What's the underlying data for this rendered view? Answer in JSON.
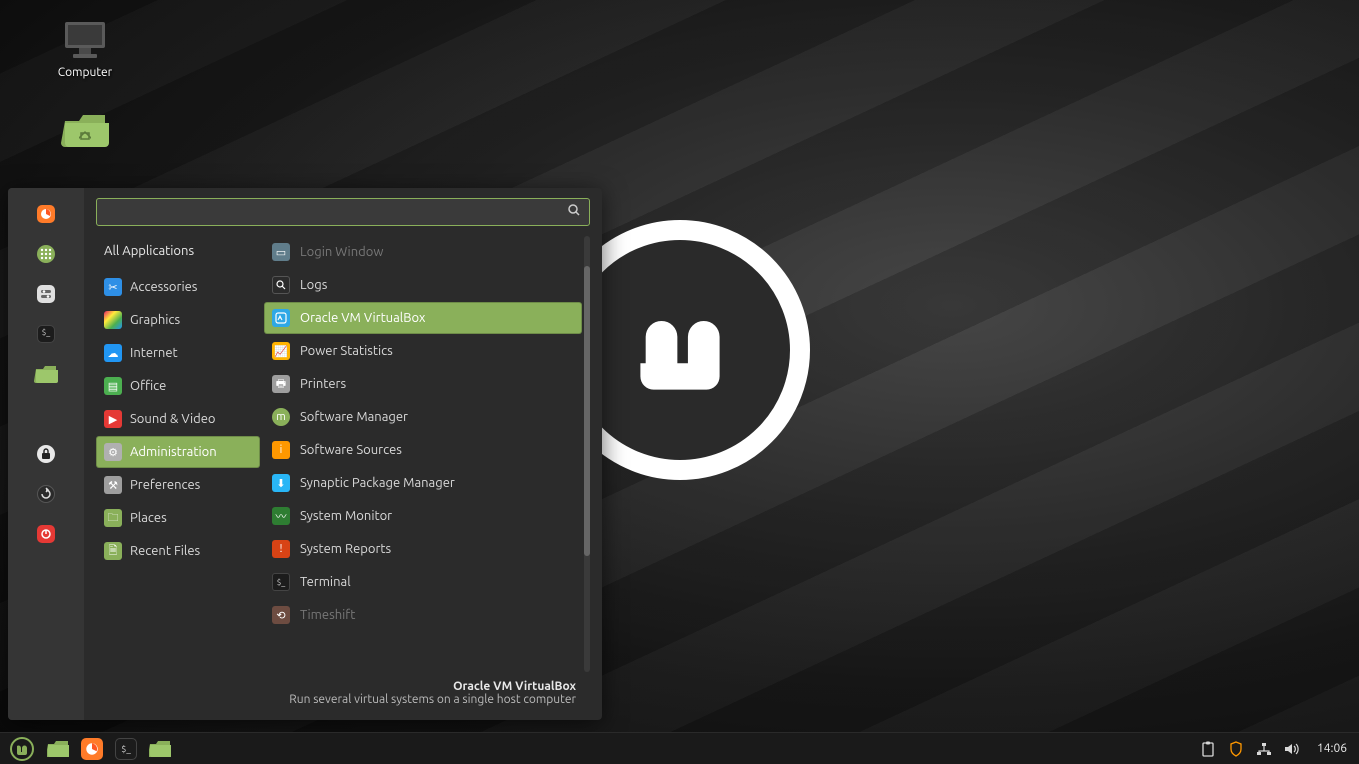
{
  "desktop": {
    "icons": [
      {
        "name": "computer",
        "label": "Computer"
      },
      {
        "name": "home",
        "label": ""
      }
    ]
  },
  "menu": {
    "search_placeholder": "",
    "sidebar": [
      {
        "name": "firefox"
      },
      {
        "name": "apps-grid"
      },
      {
        "name": "settings"
      },
      {
        "name": "terminal"
      },
      {
        "name": "files"
      },
      {
        "name": "lock"
      },
      {
        "name": "session"
      },
      {
        "name": "power"
      }
    ],
    "categories_header": "All Applications",
    "categories": [
      {
        "label": "Accessories",
        "icon": "scissors",
        "color": "#2e8fe6"
      },
      {
        "label": "Graphics",
        "icon": "palette",
        "color": "linear"
      },
      {
        "label": "Internet",
        "icon": "cloud",
        "color": "#2196f3"
      },
      {
        "label": "Office",
        "icon": "office",
        "color": "#4caf50"
      },
      {
        "label": "Sound & Video",
        "icon": "play",
        "color": "#e53935"
      },
      {
        "label": "Administration",
        "icon": "admin",
        "color": "#b0b0b0",
        "active": true
      },
      {
        "label": "Preferences",
        "icon": "prefs",
        "color": "#9e9e9e"
      },
      {
        "label": "Places",
        "icon": "folder",
        "color": "#8ab05a"
      },
      {
        "label": "Recent Files",
        "icon": "recent",
        "color": "#8ab05a"
      }
    ],
    "apps": [
      {
        "label": "Login Window",
        "icon": "login",
        "color": "#607d8b",
        "dim": true
      },
      {
        "label": "Logs",
        "icon": "logs",
        "color": "#2b2b2b"
      },
      {
        "label": "Oracle VM VirtualBox",
        "icon": "vbox",
        "color": "#2ea8e6",
        "selected": true
      },
      {
        "label": "Power Statistics",
        "icon": "power",
        "color": "#ffb300"
      },
      {
        "label": "Printers",
        "icon": "printer",
        "color": "#9e9e9e"
      },
      {
        "label": "Software Manager",
        "icon": "swmgr",
        "color": "#8ab05a"
      },
      {
        "label": "Software Sources",
        "icon": "swsrc",
        "color": "#ff9800"
      },
      {
        "label": "Synaptic Package Manager",
        "icon": "synaptic",
        "color": "#29b6f6"
      },
      {
        "label": "System Monitor",
        "icon": "sysmon",
        "color": "#2e7d32"
      },
      {
        "label": "System Reports",
        "icon": "reports",
        "color": "#d84315"
      },
      {
        "label": "Terminal",
        "icon": "term",
        "color": "#2b2b2b"
      },
      {
        "label": "Timeshift",
        "icon": "timeshift",
        "color": "#6d4c41",
        "dim": true
      }
    ],
    "footer": {
      "title": "Oracle VM VirtualBox",
      "desc": "Run several virtual systems on a single host computer"
    }
  },
  "taskbar": {
    "left": [
      {
        "name": "mint-menu"
      },
      {
        "name": "files"
      },
      {
        "name": "firefox"
      },
      {
        "name": "terminal"
      },
      {
        "name": "folder-open"
      }
    ],
    "tray": [
      {
        "name": "clipboard-icon"
      },
      {
        "name": "shield-icon"
      },
      {
        "name": "network-icon"
      },
      {
        "name": "volume-icon"
      }
    ],
    "clock": "14:06"
  }
}
